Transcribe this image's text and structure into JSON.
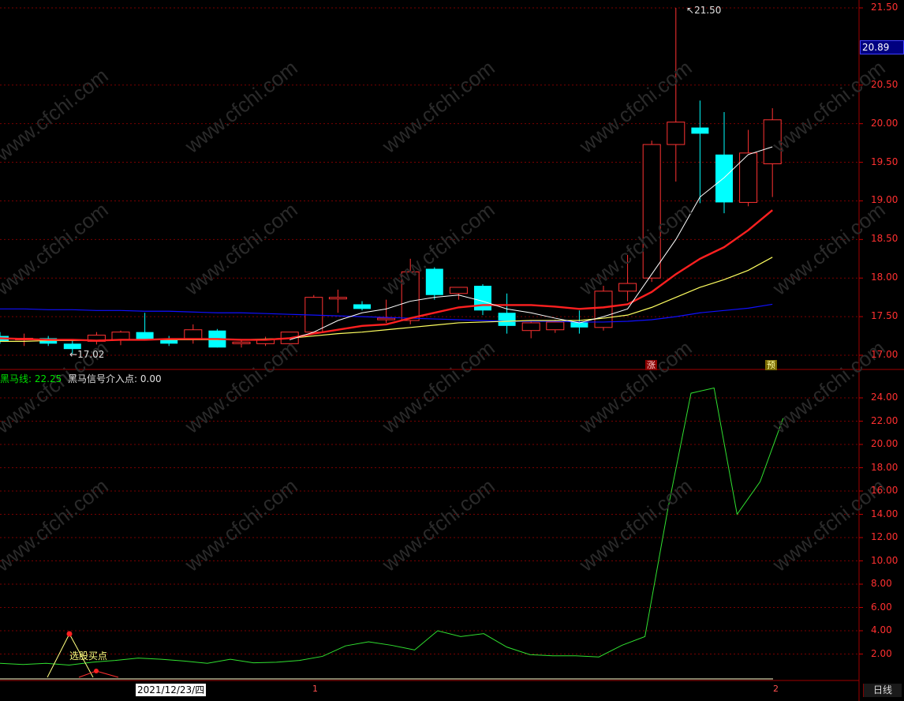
{
  "main_chart": {
    "price_ticks": [
      "21.50",
      "20.50",
      "20.00",
      "19.50",
      "19.00",
      "18.50",
      "18.00",
      "17.50",
      "17.00"
    ],
    "current_price": "20.89",
    "high_label": "21.50",
    "low_label": "17.02",
    "marker_zhang": "涨",
    "marker_yu": "预"
  },
  "sub_chart": {
    "legend_line": "黑马线: 22.25",
    "legend_signal": "黑马信号介入点: 0.00",
    "ticks": [
      "24.00",
      "22.00",
      "20.00",
      "18.00",
      "16.00",
      "14.00",
      "12.00",
      "10.00",
      "8.00",
      "6.00",
      "4.00",
      "2.00"
    ],
    "annotation": "选股买点"
  },
  "bottom_bar": {
    "date": "2021/12/23/四",
    "month_1": "1",
    "month_2": "2",
    "period": "日线"
  },
  "watermark": "www.cfchi.com",
  "colors": {
    "up": "#ff3232",
    "down": "#00ffff",
    "ma5": "#ffffff",
    "ma10": "#ff2020",
    "ma20": "#ffff60",
    "ma60": "#1010ff",
    "hm_line": "#30e030"
  },
  "chart_data": [
    {
      "type": "candlestick",
      "x_axis": "trading days",
      "ylim": [
        16.85,
        21.55
      ],
      "y_ticks": [
        17.0,
        17.5,
        18.0,
        18.5,
        19.0,
        19.5,
        20.0,
        20.5,
        21.5
      ],
      "candles": [
        {
          "o": 17.25,
          "h": 17.3,
          "l": 17.15,
          "c": 17.18
        },
        {
          "o": 17.2,
          "h": 17.28,
          "l": 17.12,
          "c": 17.22
        },
        {
          "o": 17.22,
          "h": 17.25,
          "l": 17.12,
          "c": 17.15
        },
        {
          "o": 17.15,
          "h": 17.2,
          "l": 17.02,
          "c": 17.08
        },
        {
          "o": 17.18,
          "h": 17.3,
          "l": 17.14,
          "c": 17.26
        },
        {
          "o": 17.2,
          "h": 17.32,
          "l": 17.13,
          "c": 17.3
        },
        {
          "o": 17.3,
          "h": 17.55,
          "l": 17.22,
          "c": 17.2
        },
        {
          "o": 17.2,
          "h": 17.25,
          "l": 17.12,
          "c": 17.15
        },
        {
          "o": 17.2,
          "h": 17.4,
          "l": 17.15,
          "c": 17.33
        },
        {
          "o": 17.32,
          "h": 17.34,
          "l": 17.1,
          "c": 17.1
        },
        {
          "o": 17.15,
          "h": 17.2,
          "l": 17.1,
          "c": 17.17
        },
        {
          "o": 17.15,
          "h": 17.24,
          "l": 17.12,
          "c": 17.2
        },
        {
          "o": 17.15,
          "h": 17.3,
          "l": 17.12,
          "c": 17.3
        },
        {
          "o": 17.3,
          "h": 17.78,
          "l": 17.28,
          "c": 17.75
        },
        {
          "o": 17.75,
          "h": 17.85,
          "l": 17.55,
          "c": 17.75
        },
        {
          "o": 17.66,
          "h": 17.7,
          "l": 17.58,
          "c": 17.6
        },
        {
          "o": 17.48,
          "h": 17.72,
          "l": 17.42,
          "c": 17.48
        },
        {
          "o": 17.45,
          "h": 18.25,
          "l": 17.4,
          "c": 18.08
        },
        {
          "o": 18.12,
          "h": 18.14,
          "l": 17.72,
          "c": 17.78
        },
        {
          "o": 17.8,
          "h": 17.88,
          "l": 17.72,
          "c": 17.88
        },
        {
          "o": 17.9,
          "h": 17.92,
          "l": 17.52,
          "c": 17.58
        },
        {
          "o": 17.55,
          "h": 17.8,
          "l": 17.28,
          "c": 17.38
        },
        {
          "o": 17.32,
          "h": 17.45,
          "l": 17.22,
          "c": 17.42
        },
        {
          "o": 17.33,
          "h": 17.46,
          "l": 17.29,
          "c": 17.43
        },
        {
          "o": 17.43,
          "h": 17.58,
          "l": 17.28,
          "c": 17.36
        },
        {
          "o": 17.36,
          "h": 17.9,
          "l": 17.32,
          "c": 17.83
        },
        {
          "o": 17.83,
          "h": 18.3,
          "l": 17.7,
          "c": 17.93
        },
        {
          "o": 18.0,
          "h": 19.78,
          "l": 17.95,
          "c": 19.73
        },
        {
          "o": 19.73,
          "h": 21.5,
          "l": 19.25,
          "c": 20.02
        },
        {
          "o": 19.95,
          "h": 20.3,
          "l": 18.97,
          "c": 19.87
        },
        {
          "o": 19.6,
          "h": 20.15,
          "l": 18.84,
          "c": 18.98
        },
        {
          "o": 18.98,
          "h": 19.92,
          "l": 18.93,
          "c": 19.62
        },
        {
          "o": 19.48,
          "h": 20.2,
          "l": 19.05,
          "c": 20.05
        }
      ],
      "ma5": [
        17.25,
        17.22,
        17.18,
        17.17,
        17.18,
        17.2,
        17.2,
        17.2,
        17.21,
        17.2,
        17.2,
        17.18,
        17.2,
        17.3,
        17.45,
        17.55,
        17.6,
        17.7,
        17.75,
        17.78,
        17.7,
        17.6,
        17.55,
        17.48,
        17.42,
        17.5,
        17.6,
        18.05,
        18.5,
        19.05,
        19.3,
        19.6,
        19.7
      ],
      "ma10": [
        17.22,
        17.21,
        17.2,
        17.2,
        17.19,
        17.2,
        17.2,
        17.21,
        17.21,
        17.21,
        17.2,
        17.2,
        17.22,
        17.28,
        17.33,
        17.38,
        17.4,
        17.48,
        17.55,
        17.62,
        17.65,
        17.65,
        17.65,
        17.63,
        17.6,
        17.62,
        17.66,
        17.82,
        18.05,
        18.25,
        18.4,
        18.62,
        18.88
      ],
      "ma20": [
        17.18,
        17.18,
        17.19,
        17.19,
        17.19,
        17.2,
        17.2,
        17.2,
        17.2,
        17.2,
        17.2,
        17.21,
        17.22,
        17.25,
        17.28,
        17.3,
        17.33,
        17.36,
        17.39,
        17.42,
        17.43,
        17.44,
        17.45,
        17.45,
        17.45,
        17.48,
        17.52,
        17.62,
        17.75,
        17.88,
        17.98,
        18.1,
        18.27
      ],
      "ma60": [
        17.6,
        17.6,
        17.59,
        17.59,
        17.58,
        17.58,
        17.57,
        17.57,
        17.56,
        17.55,
        17.55,
        17.54,
        17.53,
        17.52,
        17.51,
        17.5,
        17.49,
        17.48,
        17.47,
        17.46,
        17.45,
        17.44,
        17.44,
        17.44,
        17.43,
        17.43,
        17.44,
        17.46,
        17.5,
        17.55,
        17.58,
        17.61,
        17.66
      ]
    },
    {
      "type": "line",
      "title": "黑马线",
      "ylim": [
        0,
        26
      ],
      "y_ticks": [
        2,
        4,
        6,
        8,
        10,
        12,
        14,
        16,
        18,
        20,
        22,
        24
      ],
      "series": [
        {
          "name": "黑马线",
          "values": [
            1.2,
            1.1,
            1.2,
            1.05,
            1.3,
            1.45,
            1.65,
            1.55,
            1.4,
            1.2,
            1.55,
            1.25,
            1.3,
            1.45,
            1.8,
            2.7,
            3.05,
            2.75,
            2.35,
            4.0,
            3.5,
            3.75,
            2.6,
            1.95,
            1.85,
            1.85,
            1.75,
            2.75,
            3.5,
            14.5,
            24.4,
            24.85,
            14.0,
            16.8,
            22.25
          ]
        }
      ],
      "signal_points": [
        {
          "label": "选股买点",
          "value": 3.8
        }
      ]
    }
  ]
}
